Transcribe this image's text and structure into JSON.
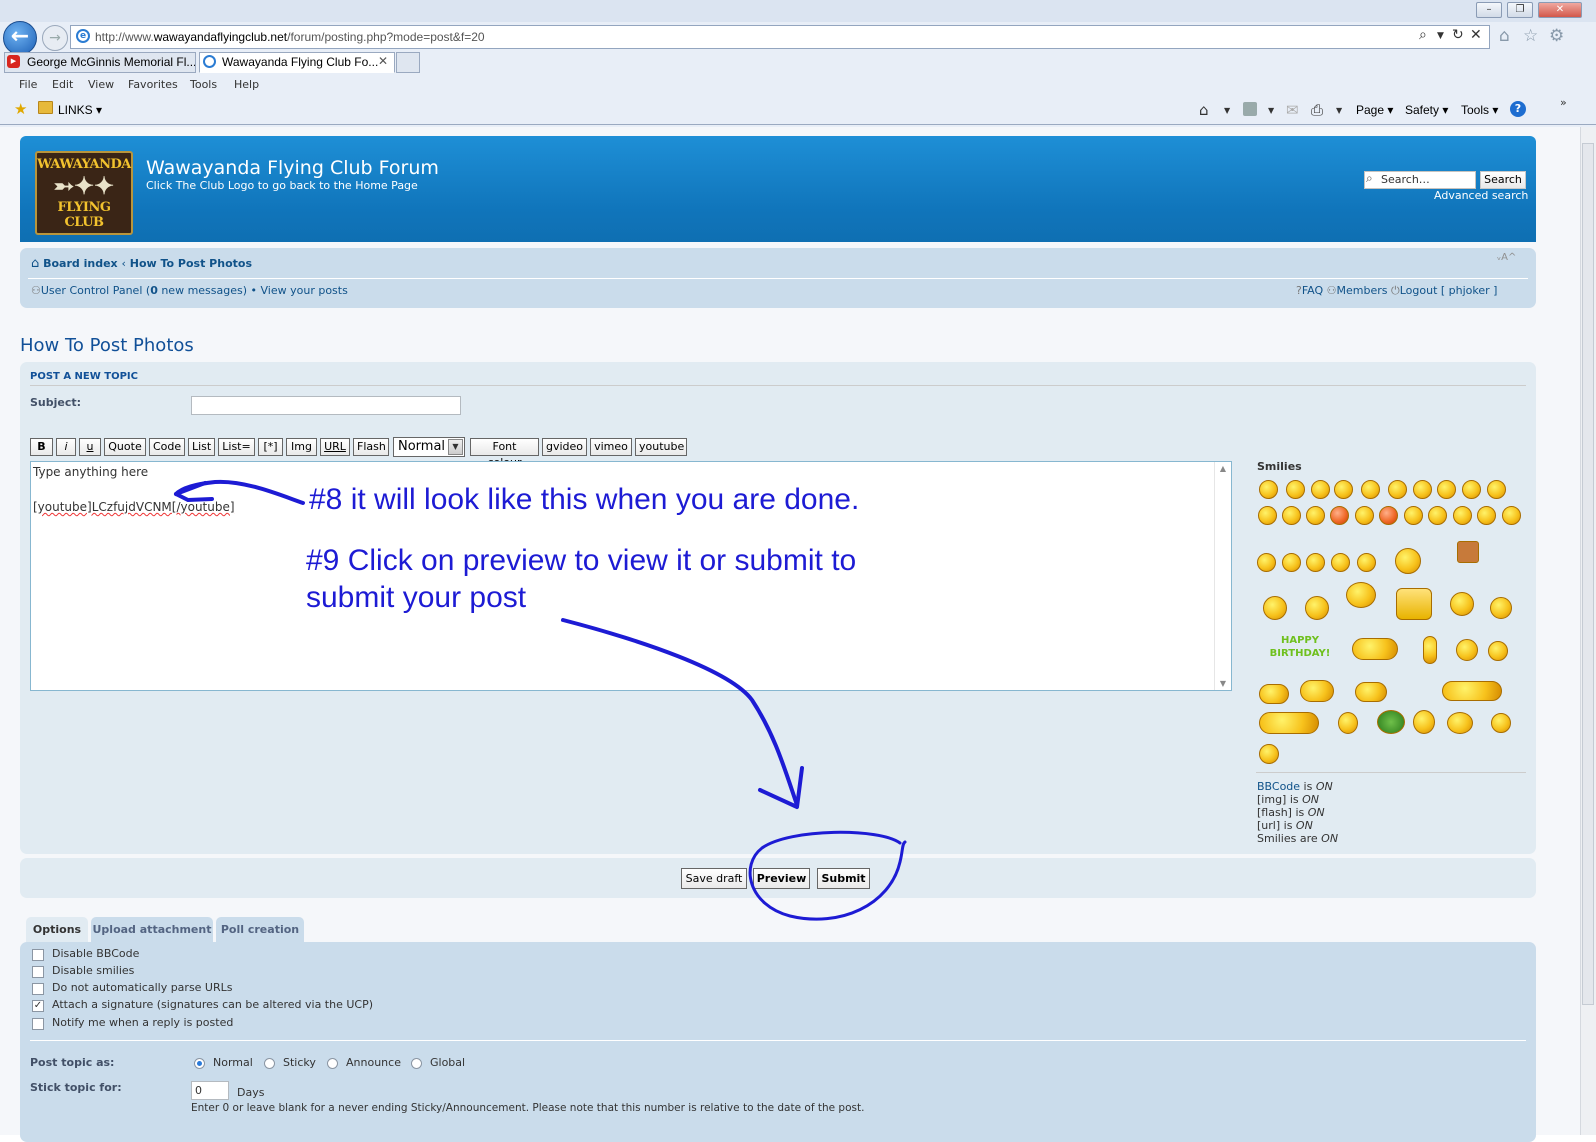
{
  "browser": {
    "window_controls": [
      "–",
      "❐",
      "✕"
    ],
    "address_prefix": "http://www.",
    "address_domain": "wawayandaflyingclub.net",
    "address_path": "/forum/posting.php?mode=post&f=20",
    "tabs": [
      {
        "label": "George McGinnis Memorial Fl...",
        "icon": "youtube-icon"
      },
      {
        "label": "Wawayanda Flying Club Fo...",
        "icon": "ie-icon",
        "close": "✕"
      }
    ],
    "menu": [
      "File",
      "Edit",
      "View",
      "Favorites",
      "Tools",
      "Help"
    ],
    "favorites": {
      "links_label": "LINKS ▾"
    },
    "commands": [
      "Page ▾",
      "Safety ▾",
      "Tools ▾"
    ]
  },
  "site": {
    "logo_top": "WAWAYANDA",
    "logo_bottom": "FLYING CLUB",
    "name": "Wawayanda Flying Club Forum",
    "description": "Click The Club Logo to go back to the Home Page",
    "search_placeholder": "Search…",
    "search_button": "Search",
    "advanced_search": "Advanced search"
  },
  "nav": {
    "board_index": "Board index",
    "separator": "‹",
    "forum": "How To Post Photos",
    "ucp": "User Control Panel",
    "ucp_open": " (",
    "new_messages_count": "0",
    "new_messages": " new messages)",
    "bullet": " • ",
    "view_posts": "View your posts",
    "faq": "FAQ",
    "members": "Members",
    "logout": "Logout [ phjoker ]",
    "font_resize": "ᵥA^"
  },
  "page_title": "How To Post Photos",
  "post": {
    "header": "POST A NEW TOPIC",
    "subject_label": "Subject:",
    "subject_value": "",
    "toolbar": [
      "B",
      "i",
      "u",
      "Quote",
      "Code",
      "List",
      "List=",
      "[*]",
      "Img",
      "URL",
      "Flash"
    ],
    "font_size": "Normal",
    "toolbar2": [
      "Font colour",
      "gvideo",
      "vimeo",
      "youtube"
    ],
    "body_line1": "Type anything here",
    "body_line3": "[youtube]LCzfujdVCNM[/youtube]",
    "smilies_label": "Smilies",
    "bbcode_info": [
      {
        "k": "BBCode",
        "v": "ON",
        "link": true,
        "verb": " is "
      },
      {
        "k": "[img]",
        "v": "ON",
        "verb": " is "
      },
      {
        "k": "[flash]",
        "v": "ON",
        "verb": " is "
      },
      {
        "k": "[url]",
        "v": "ON",
        "verb": " is "
      },
      {
        "k": "Smilies",
        "v": "ON",
        "verb": " are "
      }
    ]
  },
  "annotations": {
    "step8": "#8  it will look like this when you are done.",
    "step9_line1": "#9 Click on preview to view it or submit to",
    "step9_line2": "submit your post"
  },
  "buttons": {
    "save_draft": "Save draft",
    "preview": "Preview",
    "submit": "Submit"
  },
  "option_tabs": [
    "Options",
    "Upload attachment",
    "Poll creation"
  ],
  "options": [
    {
      "label": "Disable BBCode",
      "checked": false
    },
    {
      "label": "Disable smilies",
      "checked": false
    },
    {
      "label": "Do not automatically parse URLs",
      "checked": false
    },
    {
      "label": "Attach a signature (signatures can be altered via the UCP)",
      "checked": true
    },
    {
      "label": "Notify me when a reply is posted",
      "checked": false
    }
  ],
  "post_topic_as": {
    "label": "Post topic as:",
    "choices": [
      "Normal",
      "Sticky",
      "Announce",
      "Global"
    ],
    "selected": "Normal"
  },
  "stick_topic": {
    "label": "Stick topic for:",
    "value": "0",
    "unit": "Days",
    "note": "Enter 0 or leave blank for a never ending Sticky/Announcement. Please note that this number is relative to the date of the post."
  },
  "colors": {
    "header_blue": "#1075bb",
    "nav_bg": "#cadceb",
    "panel_bg": "#e1ebf2",
    "link": "#105289",
    "annotation_ink": "#1d1bd4"
  }
}
